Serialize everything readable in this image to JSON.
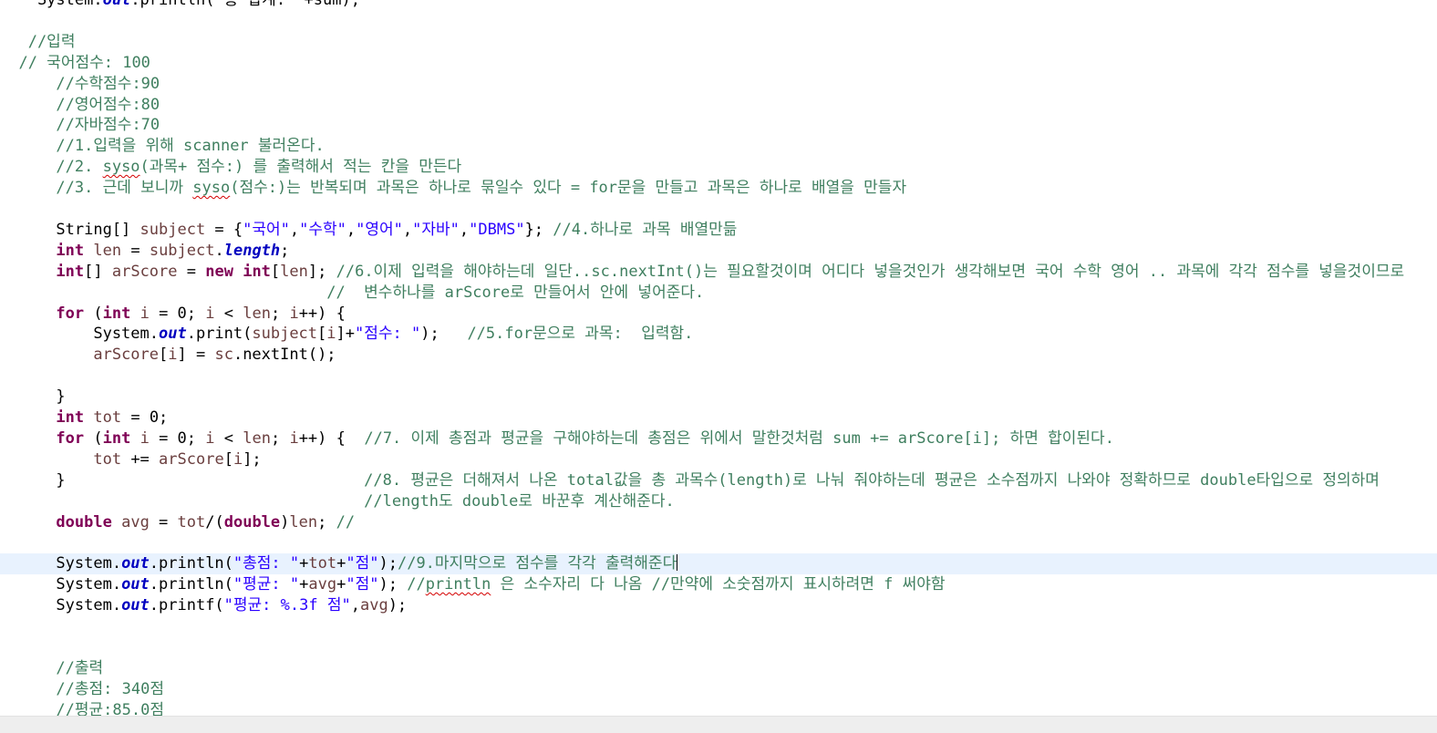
{
  "editor": {
    "lines": [
      [
        {
          "t": "    System.",
          "c": "plain"
        },
        {
          "t": "out",
          "c": "field"
        },
        {
          "t": ".println(\"총 합계: \"+sum);",
          "c": "plain"
        }
      ],
      [],
      [
        {
          "t": "   //입력",
          "c": "comment"
        }
      ],
      [
        {
          "t": "  // 국어점수: 100",
          "c": "comment"
        }
      ],
      [
        {
          "t": "      //수학점수:90",
          "c": "comment"
        }
      ],
      [
        {
          "t": "      //영어점수:80",
          "c": "comment"
        }
      ],
      [
        {
          "t": "      //자바점수:70",
          "c": "comment"
        }
      ],
      [
        {
          "t": "      //1.입력을 위해 scanner 불러온다.",
          "c": "comment"
        }
      ],
      [
        {
          "t": "      //2. ",
          "c": "comment"
        },
        {
          "t": "syso",
          "c": "comment squiggle"
        },
        {
          "t": "(과목+ 점수:) 를 출력해서 적는 칸을 만든다",
          "c": "comment"
        }
      ],
      [
        {
          "t": "      //3. 근데 보니까 ",
          "c": "comment"
        },
        {
          "t": "syso",
          "c": "comment squiggle"
        },
        {
          "t": "(점수:)는 반복되며 과목은 하나로 묶일수 있다 = for문을 만들고 과목은 하나로 배열을 만들자",
          "c": "comment"
        }
      ],
      [],
      [
        {
          "t": "      String[] ",
          "c": "plain"
        },
        {
          "t": "subject",
          "c": "var"
        },
        {
          "t": " = {",
          "c": "plain"
        },
        {
          "t": "\"국어\"",
          "c": "string"
        },
        {
          "t": ",",
          "c": "plain"
        },
        {
          "t": "\"수학\"",
          "c": "string"
        },
        {
          "t": ",",
          "c": "plain"
        },
        {
          "t": "\"영어\"",
          "c": "string"
        },
        {
          "t": ",",
          "c": "plain"
        },
        {
          "t": "\"자바\"",
          "c": "string"
        },
        {
          "t": ",",
          "c": "plain"
        },
        {
          "t": "\"DBMS\"",
          "c": "string"
        },
        {
          "t": "}; ",
          "c": "plain"
        },
        {
          "t": "//4.하나로 과목 배열만듦",
          "c": "comment"
        }
      ],
      [
        {
          "t": "      ",
          "c": "plain"
        },
        {
          "t": "int",
          "c": "keyword"
        },
        {
          "t": " ",
          "c": "plain"
        },
        {
          "t": "len",
          "c": "var"
        },
        {
          "t": " = ",
          "c": "plain"
        },
        {
          "t": "subject",
          "c": "var"
        },
        {
          "t": ".",
          "c": "plain"
        },
        {
          "t": "length",
          "c": "field"
        },
        {
          "t": ";",
          "c": "plain"
        }
      ],
      [
        {
          "t": "      ",
          "c": "plain"
        },
        {
          "t": "int",
          "c": "keyword"
        },
        {
          "t": "[] ",
          "c": "plain"
        },
        {
          "t": "arScore",
          "c": "var"
        },
        {
          "t": " = ",
          "c": "plain"
        },
        {
          "t": "new",
          "c": "keyword"
        },
        {
          "t": " ",
          "c": "plain"
        },
        {
          "t": "int",
          "c": "keyword"
        },
        {
          "t": "[",
          "c": "plain"
        },
        {
          "t": "len",
          "c": "var"
        },
        {
          "t": "]; ",
          "c": "plain"
        },
        {
          "t": "//6.이제 입력을 해야하는데 일단..sc.nextInt()는 필요할것이며 어디다 넣을것인가 생각해보면 국어 수학 영어 .. 과목에 각각 점수를 넣을것이므로",
          "c": "comment"
        }
      ],
      [
        {
          "t": "                                   //  변수하나를 arScore로 만들어서 안에 넣어준다.",
          "c": "comment"
        }
      ],
      [
        {
          "t": "      ",
          "c": "plain"
        },
        {
          "t": "for",
          "c": "keyword"
        },
        {
          "t": " (",
          "c": "plain"
        },
        {
          "t": "int",
          "c": "keyword"
        },
        {
          "t": " ",
          "c": "plain"
        },
        {
          "t": "i",
          "c": "var"
        },
        {
          "t": " = 0; ",
          "c": "plain"
        },
        {
          "t": "i",
          "c": "var"
        },
        {
          "t": " < ",
          "c": "plain"
        },
        {
          "t": "len",
          "c": "var"
        },
        {
          "t": "; ",
          "c": "plain"
        },
        {
          "t": "i",
          "c": "var"
        },
        {
          "t": "++) {",
          "c": "plain"
        }
      ],
      [
        {
          "t": "          System.",
          "c": "plain"
        },
        {
          "t": "out",
          "c": "field"
        },
        {
          "t": ".print(",
          "c": "plain"
        },
        {
          "t": "subject",
          "c": "var"
        },
        {
          "t": "[",
          "c": "plain"
        },
        {
          "t": "i",
          "c": "var"
        },
        {
          "t": "]+",
          "c": "plain"
        },
        {
          "t": "\"점수: \"",
          "c": "string"
        },
        {
          "t": ");   ",
          "c": "plain"
        },
        {
          "t": "//5.for문으로 과목:  입력함.",
          "c": "comment"
        }
      ],
      [
        {
          "t": "          ",
          "c": "plain"
        },
        {
          "t": "arScore",
          "c": "var"
        },
        {
          "t": "[",
          "c": "plain"
        },
        {
          "t": "i",
          "c": "var"
        },
        {
          "t": "] = ",
          "c": "plain"
        },
        {
          "t": "sc",
          "c": "var"
        },
        {
          "t": ".nextInt();",
          "c": "plain"
        }
      ],
      [],
      [
        {
          "t": "      }",
          "c": "plain"
        }
      ],
      [
        {
          "t": "      ",
          "c": "plain"
        },
        {
          "t": "int",
          "c": "keyword"
        },
        {
          "t": " ",
          "c": "plain"
        },
        {
          "t": "tot",
          "c": "var"
        },
        {
          "t": " = 0;",
          "c": "plain"
        }
      ],
      [
        {
          "t": "      ",
          "c": "plain"
        },
        {
          "t": "for",
          "c": "keyword"
        },
        {
          "t": " (",
          "c": "plain"
        },
        {
          "t": "int",
          "c": "keyword"
        },
        {
          "t": " ",
          "c": "plain"
        },
        {
          "t": "i",
          "c": "var"
        },
        {
          "t": " = 0; ",
          "c": "plain"
        },
        {
          "t": "i",
          "c": "var"
        },
        {
          "t": " < ",
          "c": "plain"
        },
        {
          "t": "len",
          "c": "var"
        },
        {
          "t": "; ",
          "c": "plain"
        },
        {
          "t": "i",
          "c": "var"
        },
        {
          "t": "++) {  ",
          "c": "plain"
        },
        {
          "t": "//7. 이제 총점과 평균을 구해야하는데 총점은 위에서 말한것처럼 sum += arScore[i]; 하면 합이된다.",
          "c": "comment"
        }
      ],
      [
        {
          "t": "          ",
          "c": "plain"
        },
        {
          "t": "tot",
          "c": "var"
        },
        {
          "t": " += ",
          "c": "plain"
        },
        {
          "t": "arScore",
          "c": "var"
        },
        {
          "t": "[",
          "c": "plain"
        },
        {
          "t": "i",
          "c": "var"
        },
        {
          "t": "];",
          "c": "plain"
        }
      ],
      [
        {
          "t": "      }                                ",
          "c": "plain"
        },
        {
          "t": "//8. 평균은 더해져서 나온 total값을 총 과목수(length)로 나눠 줘야하는데 평균은 소수점까지 나와야 정확하므로 double타입으로 정의하며",
          "c": "comment"
        }
      ],
      [
        {
          "t": "                                       //length도 double로 바꾼후 계산해준다.",
          "c": "comment"
        }
      ],
      [
        {
          "t": "      ",
          "c": "plain"
        },
        {
          "t": "double",
          "c": "keyword"
        },
        {
          "t": " ",
          "c": "plain"
        },
        {
          "t": "avg",
          "c": "var"
        },
        {
          "t": " = ",
          "c": "plain"
        },
        {
          "t": "tot",
          "c": "var"
        },
        {
          "t": "/(",
          "c": "plain"
        },
        {
          "t": "double",
          "c": "keyword"
        },
        {
          "t": ")",
          "c": "plain"
        },
        {
          "t": "len",
          "c": "var"
        },
        {
          "t": "; ",
          "c": "plain"
        },
        {
          "t": "//",
          "c": "comment"
        }
      ],
      [],
      [
        {
          "t": "      System.",
          "c": "plain"
        },
        {
          "t": "out",
          "c": "field"
        },
        {
          "t": ".println(",
          "c": "plain"
        },
        {
          "t": "\"총점: \"",
          "c": "string"
        },
        {
          "t": "+",
          "c": "plain"
        },
        {
          "t": "tot",
          "c": "var"
        },
        {
          "t": "+",
          "c": "plain"
        },
        {
          "t": "\"점\"",
          "c": "string"
        },
        {
          "t": ");",
          "c": "plain"
        },
        {
          "t": "//9.마지막으로 점수를 각각 출력해준다",
          "c": "comment"
        }
      ],
      [
        {
          "t": "      System.",
          "c": "plain"
        },
        {
          "t": "out",
          "c": "field"
        },
        {
          "t": ".println(",
          "c": "plain"
        },
        {
          "t": "\"평균: \"",
          "c": "string"
        },
        {
          "t": "+",
          "c": "plain"
        },
        {
          "t": "avg",
          "c": "var"
        },
        {
          "t": "+",
          "c": "plain"
        },
        {
          "t": "\"점\"",
          "c": "string"
        },
        {
          "t": "); ",
          "c": "plain"
        },
        {
          "t": "//",
          "c": "comment"
        },
        {
          "t": "println",
          "c": "comment squiggle"
        },
        {
          "t": " 은 소수자리 다 나옴 //만약에 소숫점까지 표시하려면 f 써야함",
          "c": "comment"
        }
      ],
      [
        {
          "t": "      System.",
          "c": "plain"
        },
        {
          "t": "out",
          "c": "field"
        },
        {
          "t": ".printf(",
          "c": "plain"
        },
        {
          "t": "\"평균: %.3f 점\"",
          "c": "string"
        },
        {
          "t": ",",
          "c": "plain"
        },
        {
          "t": "avg",
          "c": "var"
        },
        {
          "t": ");",
          "c": "plain"
        }
      ],
      [],
      [],
      [
        {
          "t": "      //출력",
          "c": "comment"
        }
      ],
      [
        {
          "t": "      //총점: 340점",
          "c": "comment"
        }
      ],
      [
        {
          "t": "      //평균:85.0점",
          "c": "comment"
        }
      ]
    ],
    "current_line": 27,
    "caret_line": 27
  }
}
